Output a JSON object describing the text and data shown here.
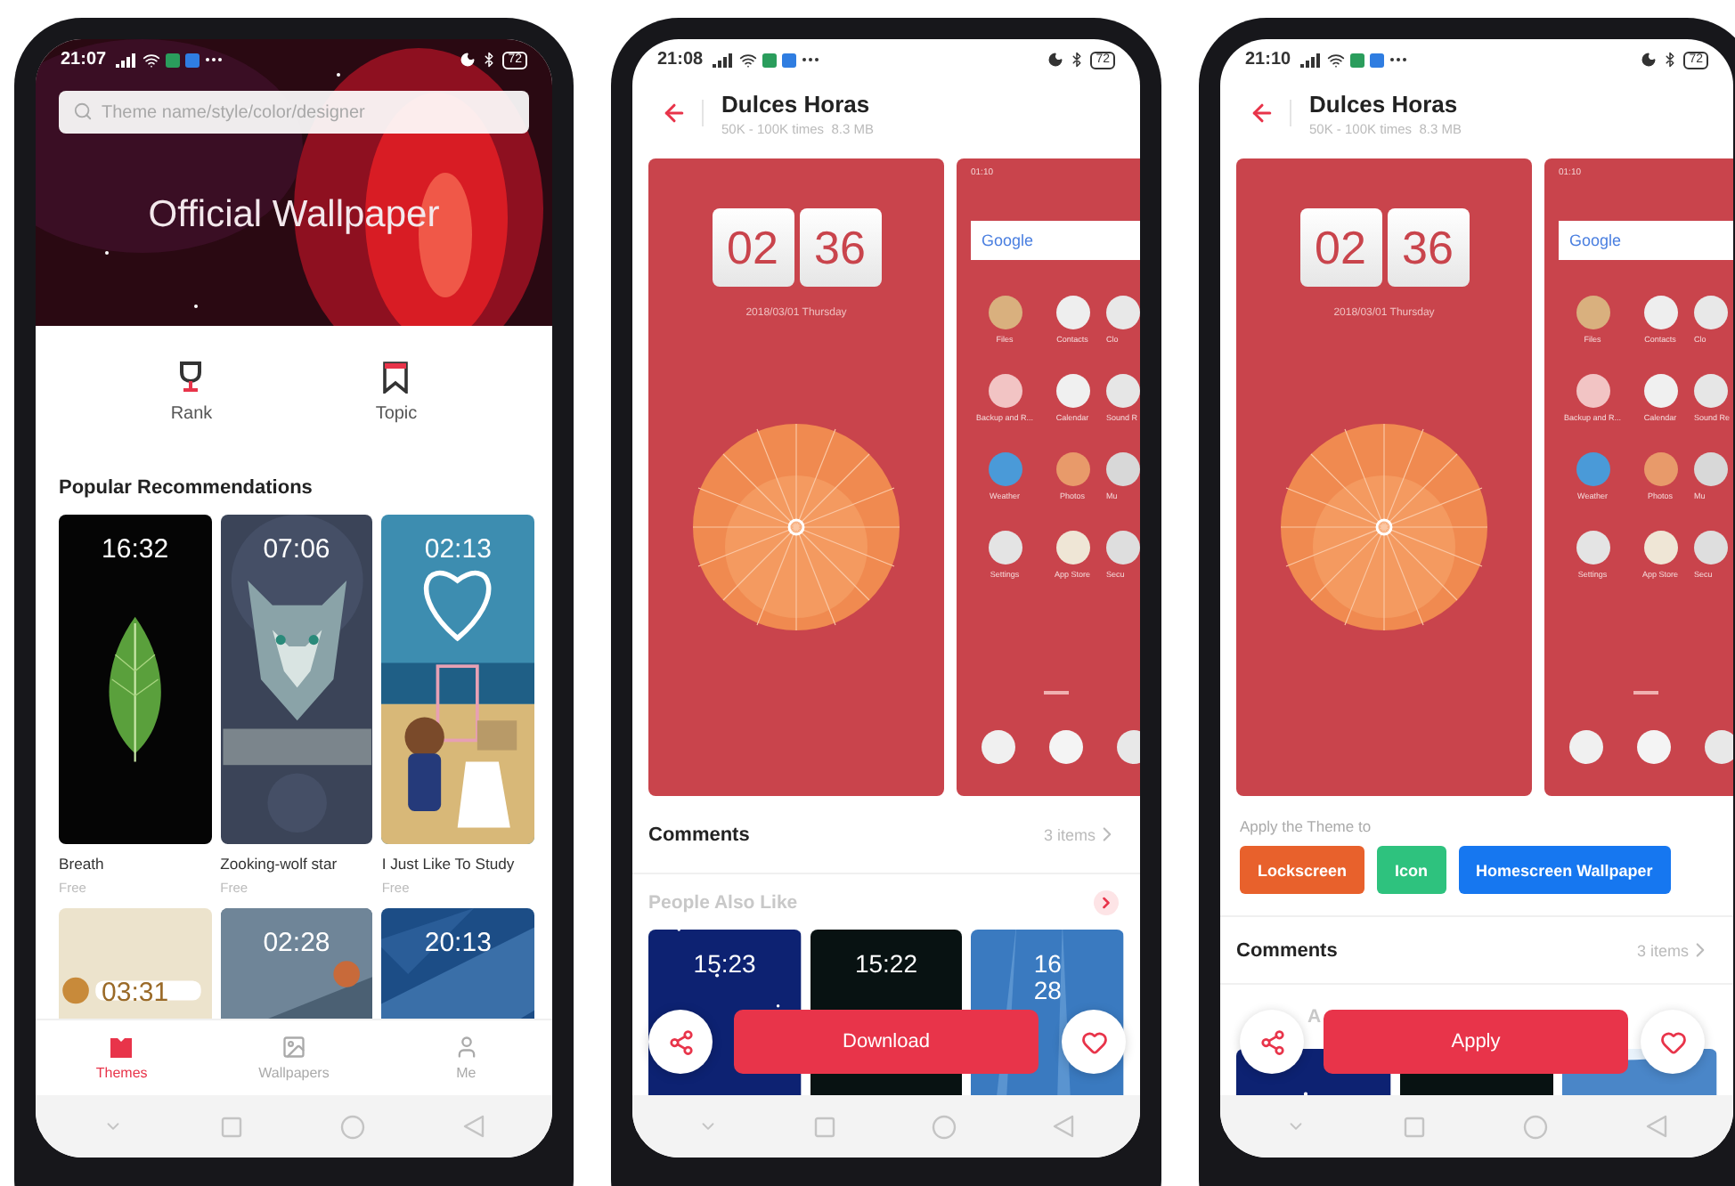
{
  "themes_screen": {
    "status": {
      "time": "21:07",
      "battery": "72"
    },
    "search": {
      "placeholder": "Theme name/style/color/designer"
    },
    "banner": {
      "title": "Official Wallpaper"
    },
    "shortcuts": [
      {
        "label": "Rank"
      },
      {
        "label": "Topic"
      }
    ],
    "section_title": "Popular Recommendations",
    "themes": [
      {
        "clock": [
          "16:32"
        ],
        "name": "Breath",
        "price": "Free"
      },
      {
        "clock": [
          "07:06"
        ],
        "name": "Zooking-wolf star",
        "price": "Free"
      },
      {
        "clock": [
          "02:13"
        ],
        "name": "I Just Like To Study",
        "price": "Free"
      },
      {
        "clock": [
          "03:31"
        ]
      },
      {
        "clock": [
          "02:28"
        ]
      },
      {
        "clock": [
          "20:13"
        ]
      }
    ],
    "tabs": [
      {
        "label": "Themes",
        "selected": true
      },
      {
        "label": "Wallpapers",
        "selected": false
      },
      {
        "label": "Me",
        "selected": false
      }
    ]
  },
  "detail_screen": {
    "status": {
      "time": "21:08",
      "battery": "72"
    },
    "title": "Dulces Horas",
    "meta": "50K - 100K times  8.3 MB",
    "lock_preview": {
      "hours": "02",
      "minutes": "36",
      "date": "2018/03/01 Thursday"
    },
    "home_preview": {
      "time": "01:10",
      "search": "Google",
      "apps": [
        "Files",
        "Contacts",
        "Clo",
        "Backup and R...",
        "Calendar",
        "Sound R",
        "Weather",
        "Photos",
        "Mu",
        "Settings",
        "App Store",
        "Secu"
      ]
    },
    "comments": {
      "title": "Comments",
      "count": "3 items"
    },
    "also_like": {
      "title": "People Also Like",
      "items": [
        {
          "kind": "picture",
          "clock": [
            "15:23"
          ]
        },
        {
          "kind": "picture",
          "clock": [
            "15:22"
          ]
        },
        {
          "kind": "picture",
          "clock": [
            "16",
            "28"
          ]
        }
      ]
    },
    "action": "Download"
  },
  "apply_screen": {
    "status": {
      "time": "21:10",
      "battery": "72"
    },
    "title": "Dulces Horas",
    "meta": "50K - 100K times  8.3 MB",
    "lock_preview": {
      "hours": "02",
      "minutes": "36",
      "date": "2018/03/01 Thursday"
    },
    "home_preview": {
      "time": "01:10",
      "search": "Google",
      "apps": [
        "Files",
        "Contacts",
        "Clo",
        "Backup and R...",
        "Calendar",
        "Sound Re",
        "Weather",
        "Photos",
        "Mu",
        "Settings",
        "App Store",
        "Secu"
      ]
    },
    "apply_to": {
      "label": "Apply the Theme to",
      "options": [
        {
          "label": "Lockscreen",
          "color": "#e8612c"
        },
        {
          "label": "Icon",
          "color": "#2ec27e"
        },
        {
          "label": "Homescreen Wallpaper",
          "color": "#1677f0"
        }
      ]
    },
    "comments": {
      "title": "Comments",
      "count": "3 items"
    },
    "also_like": {
      "title": "A"
    },
    "action": "Apply"
  }
}
